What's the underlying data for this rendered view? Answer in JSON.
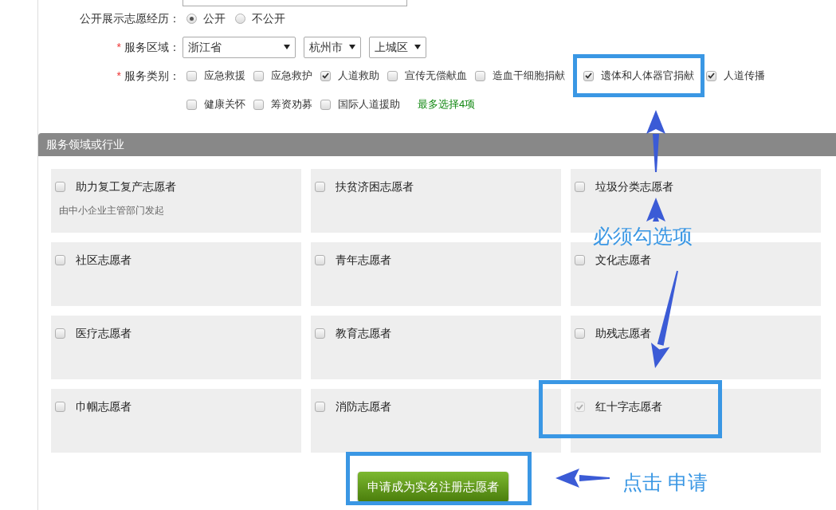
{
  "form": {
    "publicity": {
      "label": "公开展示志愿经历：",
      "options": [
        {
          "label": "公开",
          "selected": true
        },
        {
          "label": "不公开",
          "selected": false
        }
      ]
    },
    "region": {
      "required_mark": "*",
      "label": "服务区域：",
      "selects": [
        "浙江省",
        "杭州市",
        "上城区"
      ]
    },
    "categories": {
      "required_mark": "*",
      "label": "服务类别：",
      "items": [
        {
          "label": "应急救援",
          "checked": false,
          "highlighted": false
        },
        {
          "label": "应急救护",
          "checked": false,
          "highlighted": false
        },
        {
          "label": "人道救助",
          "checked": true,
          "highlighted": false
        },
        {
          "label": "宣传无偿献血",
          "checked": false,
          "highlighted": false
        },
        {
          "label": "造血干细胞捐献",
          "checked": false,
          "highlighted": false
        },
        {
          "label": "遗体和人体器官捐献",
          "checked": true,
          "highlighted": true
        },
        {
          "label": "人道传播",
          "checked": true,
          "highlighted": false
        },
        {
          "label": "健康关怀",
          "checked": false,
          "highlighted": false
        },
        {
          "label": "筹资劝募",
          "checked": false,
          "highlighted": false
        },
        {
          "label": "国际人道援助",
          "checked": false,
          "highlighted": false
        }
      ],
      "hint": "最多选择4项"
    }
  },
  "section": {
    "title": "服务领域或行业",
    "cards": [
      {
        "label": "助力复工复产志愿者",
        "note": "由中小企业主管部门发起",
        "checked": false,
        "disabled": false
      },
      {
        "label": "扶贫济困志愿者",
        "checked": false,
        "disabled": false
      },
      {
        "label": "垃圾分类志愿者",
        "checked": false,
        "disabled": false
      },
      {
        "label": "社区志愿者",
        "checked": false,
        "disabled": false
      },
      {
        "label": "青年志愿者",
        "checked": false,
        "disabled": false
      },
      {
        "label": "文化志愿者",
        "checked": false,
        "disabled": false
      },
      {
        "label": "医疗志愿者",
        "checked": false,
        "disabled": false
      },
      {
        "label": "教育志愿者",
        "checked": false,
        "disabled": false
      },
      {
        "label": "助残志愿者",
        "checked": false,
        "disabled": false
      },
      {
        "label": "巾帼志愿者",
        "checked": false,
        "disabled": false
      },
      {
        "label": "消防志愿者",
        "checked": false,
        "disabled": false
      },
      {
        "label": "红十字志愿者",
        "checked": true,
        "disabled": true
      }
    ]
  },
  "submit_button": "申请成为实名注册志愿者",
  "annotations": {
    "required_note": "必须勾选项",
    "click_note": "点击 申请"
  }
}
